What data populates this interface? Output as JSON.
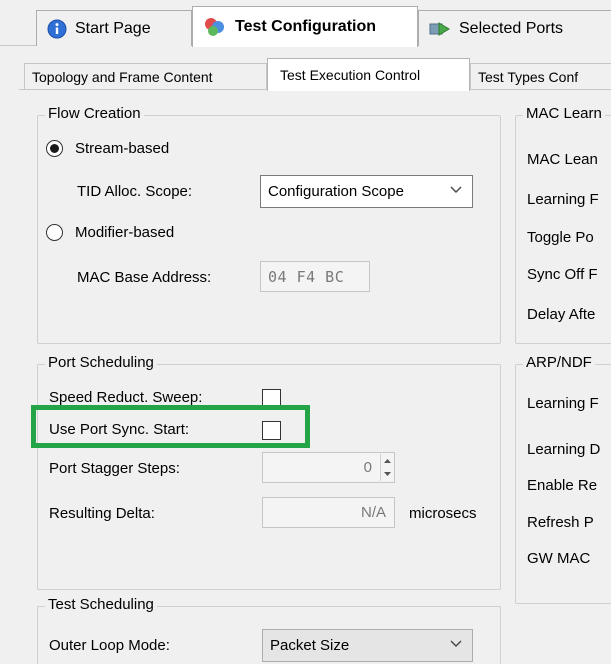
{
  "doc_tabs": [
    {
      "label": "Start Page",
      "icon": "info-icon"
    },
    {
      "label": "Test Configuration",
      "icon": "test-config-icon"
    },
    {
      "label": "Selected Ports",
      "icon": "selected-ports-icon"
    }
  ],
  "sub_tabs": [
    {
      "label": "Topology and Frame Content"
    },
    {
      "label": "Test Execution Control"
    },
    {
      "label": "Test Types Conf"
    }
  ],
  "flow_creation": {
    "title": "Flow Creation",
    "stream_based_label": "Stream-based",
    "stream_based_selected": true,
    "tid_scope_label": "TID Alloc. Scope:",
    "tid_scope_value": "Configuration Scope",
    "modifier_based_label": "Modifier-based",
    "modifier_based_selected": false,
    "mac_base_label": "MAC Base Address:",
    "mac_base_value": "04 F4 BC"
  },
  "port_scheduling": {
    "title": "Port Scheduling",
    "speed_reduct_label": "Speed Reduct. Sweep:",
    "speed_reduct_checked": false,
    "use_port_sync_label": "Use Port Sync. Start:",
    "use_port_sync_checked": false,
    "stagger_label": "Port Stagger Steps:",
    "stagger_value": "0",
    "resulting_delta_label": "Resulting Delta:",
    "resulting_delta_value": "N/A",
    "resulting_delta_unit": "microsecs"
  },
  "test_scheduling": {
    "title": "Test Scheduling",
    "outer_loop_label": "Outer Loop Mode:",
    "outer_loop_value": "Packet Size"
  },
  "mac_learning": {
    "title": "MAC Learn",
    "rows": [
      "MAC Lean",
      "Learning F",
      "Toggle Po",
      "Sync Off F",
      "Delay Afte"
    ]
  },
  "arp_ndp": {
    "title": "ARP/NDF",
    "rows": [
      "Learning F",
      "Learning D",
      "Enable Re",
      "Refresh P",
      "GW MAC"
    ]
  },
  "colors": {
    "highlight": "#22a447",
    "window_bg": "#f0f0f0"
  }
}
